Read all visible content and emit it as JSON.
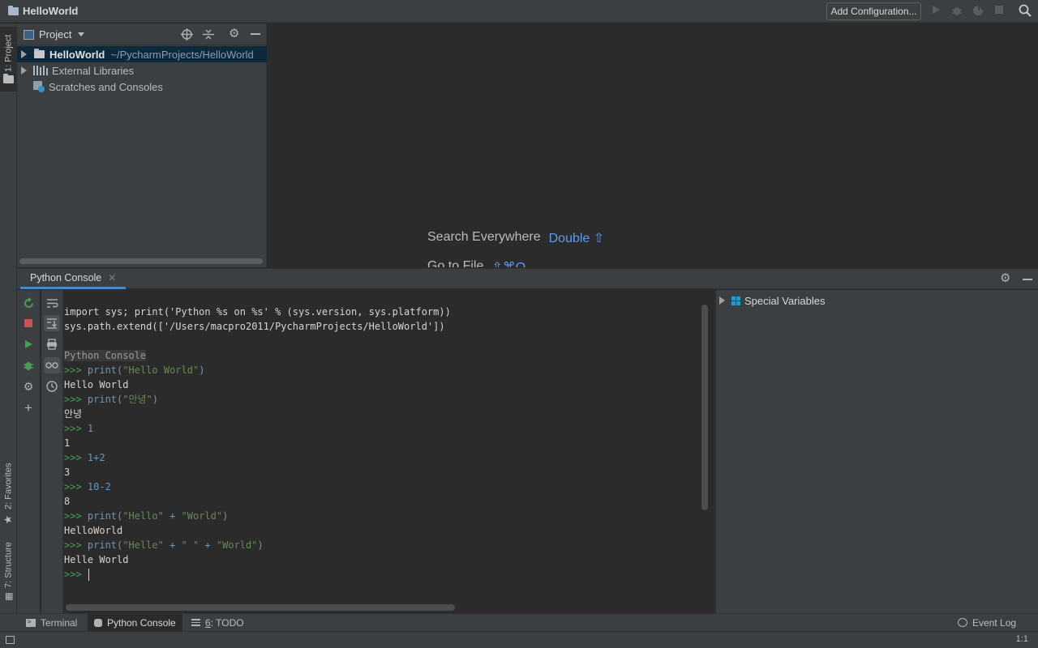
{
  "topbar": {
    "project_name": "HelloWorld",
    "add_config_label": "Add Configuration..."
  },
  "left_stripe": {
    "project_tab": "1: Project",
    "favorites_tab": "2: Favorites",
    "structure_tab": "7: Structure"
  },
  "project_panel": {
    "view_label": "Project",
    "tree": [
      {
        "label": "HelloWorld",
        "path": "~/PycharmProjects/HelloWorld"
      },
      {
        "label": "External Libraries"
      },
      {
        "label": "Scratches and Consoles"
      }
    ]
  },
  "editor_hints": {
    "search_label": "Search Everywhere",
    "search_shortcut": "Double ⇧",
    "goto_label": "Go to File",
    "goto_shortcut": "⇧⌘O"
  },
  "console": {
    "tab_label": "Python Console",
    "lines": [
      {
        "kind": "out",
        "text": "import sys; print('Python %s on %s' % (sys.version, sys.platform))"
      },
      {
        "kind": "out",
        "text": "sys.path.extend(['/Users/macpro2011/PycharmProjects/HelloWorld'])"
      },
      {
        "kind": "blank",
        "text": ""
      },
      {
        "kind": "banner",
        "text": "Python Console"
      },
      {
        "kind": "in",
        "prompt": ">>> ",
        "parts": [
          {
            "t": "print(",
            "c": "plain"
          },
          {
            "t": "\"Hello World\"",
            "c": "str"
          },
          {
            "t": ")",
            "c": "plain"
          }
        ]
      },
      {
        "kind": "out",
        "text": "Hello World"
      },
      {
        "kind": "in",
        "prompt": ">>> ",
        "parts": [
          {
            "t": "print(",
            "c": "plain"
          },
          {
            "t": "\"안녕\"",
            "c": "str"
          },
          {
            "t": ")",
            "c": "plain"
          }
        ]
      },
      {
        "kind": "out",
        "text": "안녕"
      },
      {
        "kind": "in",
        "prompt": ">>> ",
        "parts": [
          {
            "t": "1",
            "c": "num"
          }
        ]
      },
      {
        "kind": "out",
        "text": "1"
      },
      {
        "kind": "in",
        "prompt": ">>> ",
        "parts": [
          {
            "t": "1+2",
            "c": "num"
          }
        ]
      },
      {
        "kind": "out",
        "text": "3"
      },
      {
        "kind": "in",
        "prompt": ">>> ",
        "parts": [
          {
            "t": "10-2",
            "c": "num"
          }
        ]
      },
      {
        "kind": "out",
        "text": "8"
      },
      {
        "kind": "in",
        "prompt": ">>> ",
        "parts": [
          {
            "t": "print(",
            "c": "plain"
          },
          {
            "t": "\"Hello\"",
            "c": "str"
          },
          {
            "t": " + ",
            "c": "plain"
          },
          {
            "t": "\"World\"",
            "c": "str"
          },
          {
            "t": ")",
            "c": "plain"
          }
        ]
      },
      {
        "kind": "out",
        "text": "HelloWorld"
      },
      {
        "kind": "in",
        "prompt": ">>> ",
        "parts": [
          {
            "t": "print(",
            "c": "plain"
          },
          {
            "t": "\"Helle\"",
            "c": "str"
          },
          {
            "t": " + ",
            "c": "plain"
          },
          {
            "t": "\" \"",
            "c": "str"
          },
          {
            "t": " + ",
            "c": "plain"
          },
          {
            "t": "\"World\"",
            "c": "str"
          },
          {
            "t": ")",
            "c": "plain"
          }
        ]
      },
      {
        "kind": "out",
        "text": "Helle World"
      },
      {
        "kind": "prompt",
        "prompt": ">>> "
      }
    ]
  },
  "variables": {
    "special_label": "Special Variables"
  },
  "bottom_tabs": {
    "terminal": "Terminal",
    "python_console": "Python Console",
    "todo_num": "6",
    "todo": ": TODO",
    "event_log": "Event Log"
  },
  "status": {
    "position": "1:1"
  },
  "colors": {
    "accent": "#4a88c7",
    "prompt_green": "#499c54",
    "string_green": "#6a8759",
    "number_blue": "#6897bb",
    "stop_red": "#c75450"
  }
}
